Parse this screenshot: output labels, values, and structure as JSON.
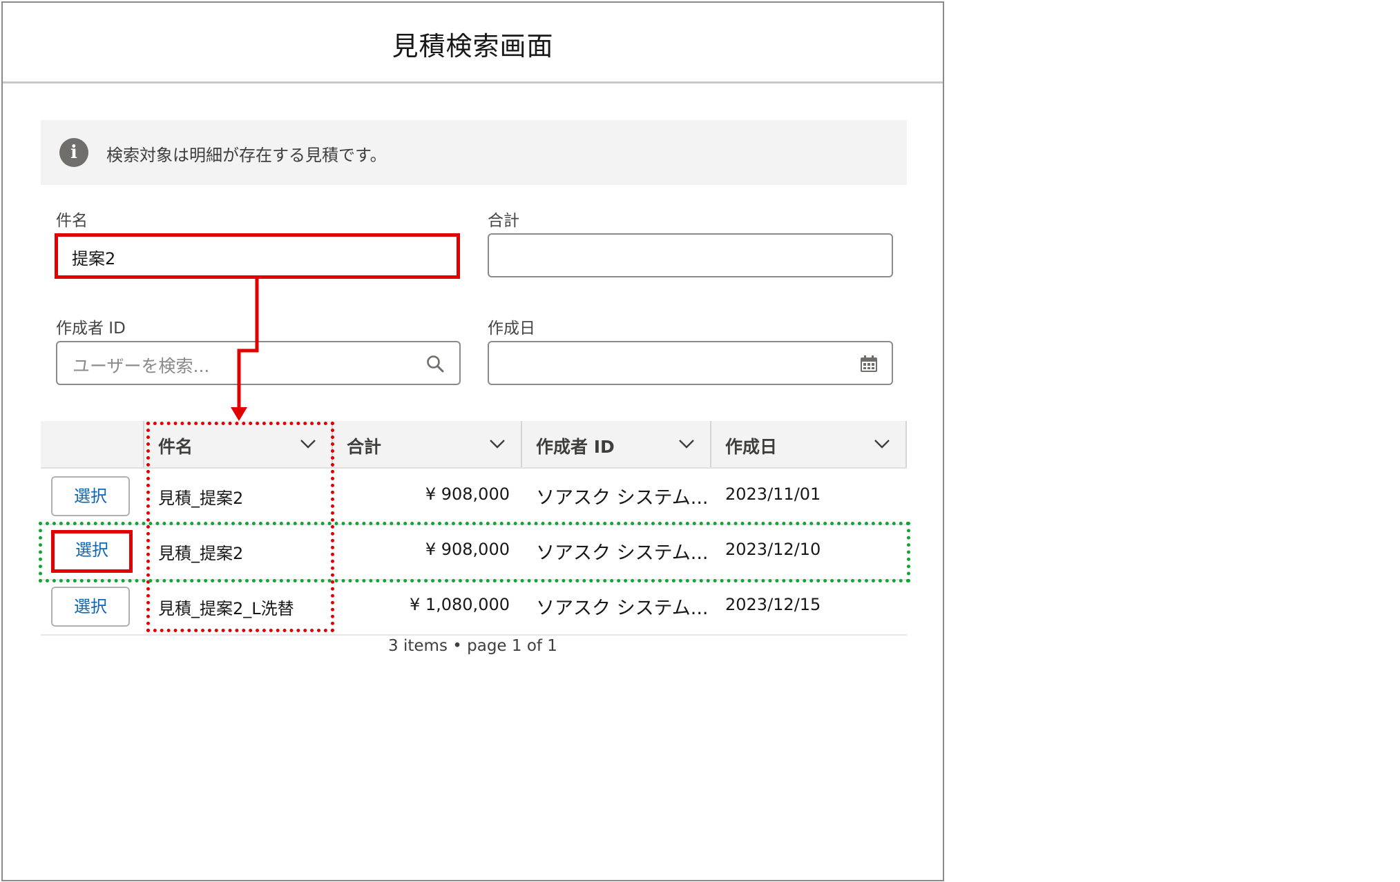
{
  "dialog": {
    "title": "見積検索画面"
  },
  "info": {
    "message": "検索対象は明細が存在する見積です。"
  },
  "form": {
    "name_label": "件名",
    "name_value": "提案2",
    "total_label": "合計",
    "total_value": "",
    "creator_label": "作成者 ID",
    "creator_placeholder": "ユーザーを検索...",
    "created_date_label": "作成日",
    "created_date_value": ""
  },
  "table": {
    "columns": [
      "件名",
      "合計",
      "作成者 ID",
      "作成日"
    ],
    "select_label": "選択",
    "rows": [
      {
        "name": "見積_提案2",
        "total": "¥ 908,000",
        "creator": "ソアスク システム...",
        "date": "2023/11/01"
      },
      {
        "name": "見積_提案2",
        "total": "¥ 908,000",
        "creator": "ソアスク システム...",
        "date": "2023/12/10"
      },
      {
        "name": "見積_提案2_L洗替",
        "total": "¥ 1,080,000",
        "creator": "ソアスク システム...",
        "date": "2023/12/15"
      }
    ],
    "footer": "3 items • page 1 of 1"
  },
  "colors": {
    "highlight_red": "#e00000",
    "highlight_green": "#12a335",
    "link_blue": "#0b67b8"
  }
}
